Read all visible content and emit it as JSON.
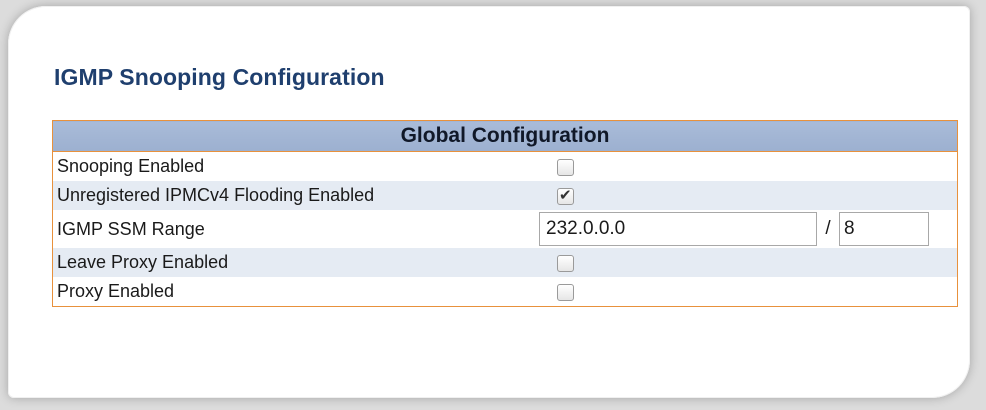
{
  "page": {
    "title": "IGMP Snooping Configuration"
  },
  "global_config": {
    "header": "Global Configuration",
    "rows": [
      {
        "label": "Snooping Enabled",
        "checked": false
      },
      {
        "label": "Unregistered IPMCv4 Flooding Enabled",
        "checked": true
      },
      {
        "label": "IGMP SSM Range",
        "ip_value": "232.0.0.0",
        "separator": "/",
        "mask_value": "8"
      },
      {
        "label": "Leave Proxy Enabled",
        "checked": false
      },
      {
        "label": "Proxy Enabled",
        "checked": false
      }
    ]
  },
  "colors": {
    "title": "#1f3f6e",
    "header_bg": "#9cb0d0",
    "border": "#e8913c",
    "alt_row": "#e5ebf3"
  }
}
